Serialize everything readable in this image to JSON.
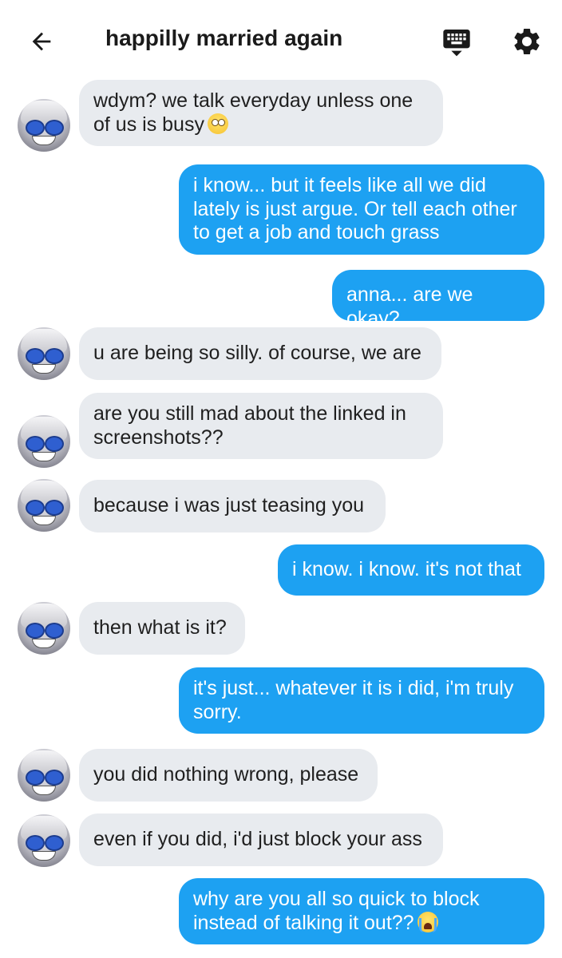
{
  "header": {
    "title": "happilly married again",
    "back_icon": "arrow-left-icon",
    "keyboard_icon": "keyboard-icon",
    "settings_icon": "gear-icon"
  },
  "colors": {
    "incoming_bubble": "#e8ebef",
    "outgoing_bubble": "#1da1f2",
    "text_dark": "#1f1f1f",
    "text_light": "#ffffff"
  },
  "messages": [
    {
      "from": "them",
      "text": "wdym? we talk everyday unless one of us is busy",
      "emoji": "face-with-rolling-eyes"
    },
    {
      "from": "me",
      "text": "i know... but it feels like all we did lately is just argue. Or tell each other to get a job and touch grass"
    },
    {
      "from": "me",
      "text": "anna... are we okay?"
    },
    {
      "from": "them",
      "text": "u are being so silly. of course, we are"
    },
    {
      "from": "them",
      "text": "are you still mad about the linked in screenshots??"
    },
    {
      "from": "them",
      "text": "because i was just teasing you"
    },
    {
      "from": "me",
      "text": "i know. i know. it's not that"
    },
    {
      "from": "them",
      "text": "then what is it?"
    },
    {
      "from": "me",
      "text": "it's just... whatever it is i did, i'm truly sorry."
    },
    {
      "from": "them",
      "text": "you did nothing wrong, please"
    },
    {
      "from": "them",
      "text": "even if you did, i'd just block your ass"
    },
    {
      "from": "me",
      "text": "why are you all so quick to block instead of talking it out??",
      "emoji": "loudly-crying-face"
    }
  ]
}
